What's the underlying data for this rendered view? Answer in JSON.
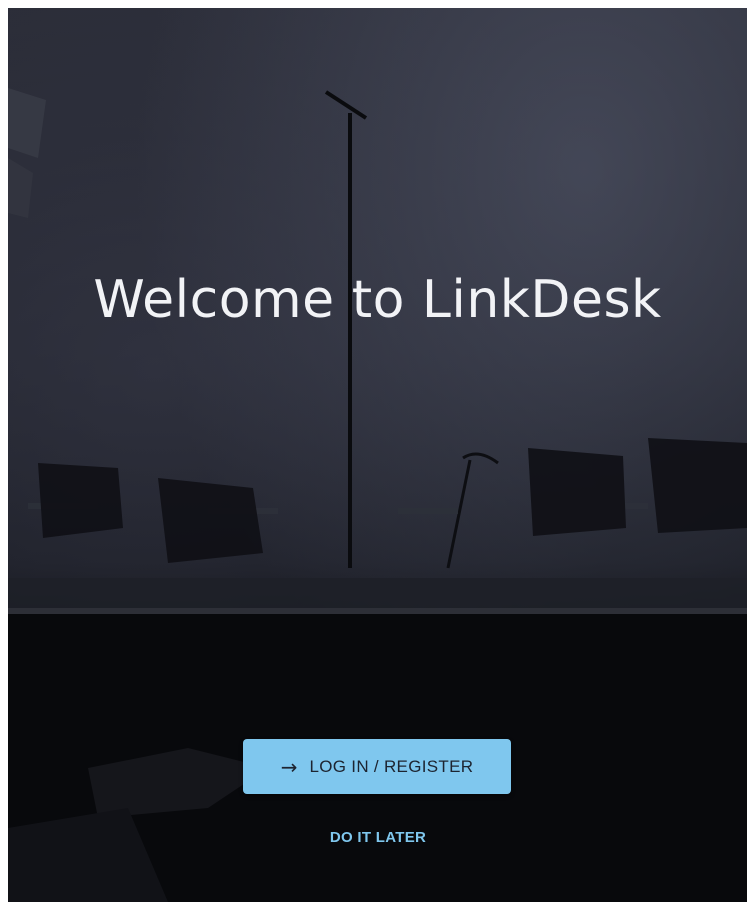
{
  "welcome": {
    "title": "Welcome to LinkDesk"
  },
  "actions": {
    "login_label": "LOG IN / REGISTER",
    "login_icon": "arrow-right-icon",
    "later_label": "DO IT LATER"
  },
  "colors": {
    "accent": "#7fc7ee",
    "background": "#14161d",
    "title_text": "#f2f3f6"
  }
}
